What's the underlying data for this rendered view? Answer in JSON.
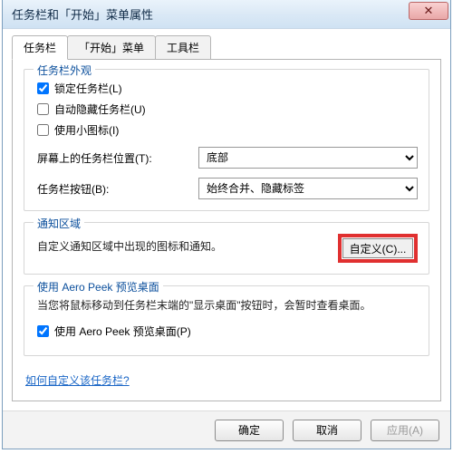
{
  "window": {
    "title": "任务栏和「开始」菜单属性",
    "close_glyph": "✕"
  },
  "tabs": {
    "taskbar": "任务栏",
    "start": "「开始」菜单",
    "toolbars": "工具栏"
  },
  "appearance": {
    "title": "任务栏外观",
    "lock": "锁定任务栏(L)",
    "lock_checked": true,
    "autohide": "自动隐藏任务栏(U)",
    "autohide_checked": false,
    "smallicons": "使用小图标(I)",
    "smallicons_checked": false,
    "position_label": "屏幕上的任务栏位置(T):",
    "position_value": "底部",
    "buttons_label": "任务栏按钮(B):",
    "buttons_value": "始终合并、隐藏标签"
  },
  "notification": {
    "title": "通知区域",
    "desc": "自定义通知区域中出现的图标和通知。",
    "custom_btn": "自定义(C)..."
  },
  "aero": {
    "title": "使用 Aero Peek 预览桌面",
    "desc": "当您将鼠标移动到任务栏末端的\"显示桌面\"按钮时，会暂时查看桌面。",
    "check_label": "使用 Aero Peek 预览桌面(P)",
    "check_checked": true
  },
  "link": "如何自定义该任务栏?",
  "buttons": {
    "ok": "确定",
    "cancel": "取消",
    "apply": "应用(A)"
  }
}
